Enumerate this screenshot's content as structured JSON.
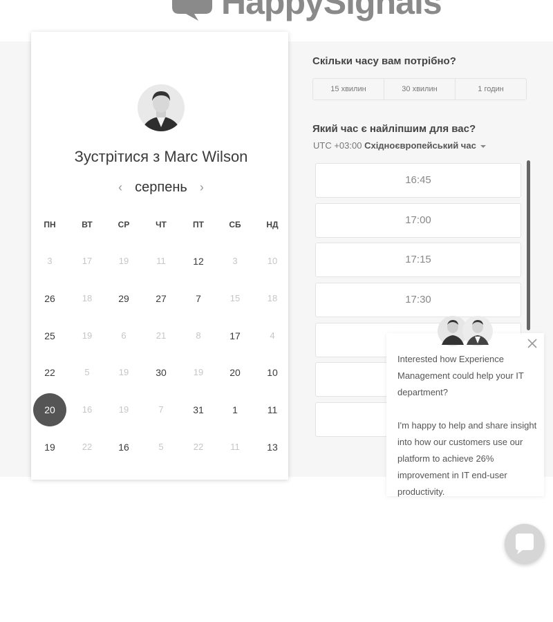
{
  "logo": {
    "text": "HappySignals"
  },
  "meeting": {
    "title": "Зустрітися з Marc Wilson",
    "month": "серпень",
    "weekdays": [
      "ПН",
      "ВТ",
      "СР",
      "ЧТ",
      "ПТ",
      "СБ",
      "НД"
    ],
    "days": [
      [
        "3",
        "17",
        "19",
        "11",
        "12",
        "3",
        "10"
      ],
      [
        "26",
        "18",
        "29",
        "27",
        "7",
        "15",
        "18"
      ],
      [
        "25",
        "19",
        "6",
        "21",
        "8",
        "17",
        "4"
      ],
      [
        "22",
        "5",
        "19",
        "30",
        "19",
        "20",
        "10"
      ],
      [
        "20",
        "16",
        "19",
        "7",
        "31",
        "1",
        "11"
      ],
      [
        "19",
        "22",
        "16",
        "5",
        "22",
        "11",
        "13"
      ]
    ],
    "available": [
      [
        false,
        false,
        false,
        false,
        true,
        false,
        false
      ],
      [
        true,
        false,
        true,
        true,
        true,
        false,
        false
      ],
      [
        true,
        false,
        false,
        false,
        false,
        true,
        false
      ],
      [
        true,
        false,
        false,
        true,
        false,
        true,
        true
      ],
      [
        true,
        false,
        false,
        false,
        true,
        true,
        true
      ],
      [
        true,
        false,
        true,
        false,
        false,
        false,
        true
      ]
    ],
    "selected_day": "20"
  },
  "duration": {
    "question": "Скільки часу вам потрібно?",
    "options": [
      "15 хвилин",
      "30 хвилин",
      "1 годин"
    ]
  },
  "time": {
    "question": "Який час є найліпшим для вас?",
    "timezone_offset": "UTC +03:00",
    "timezone_name": "Східноєвропейський час",
    "slots": [
      "16:45",
      "17:00",
      "17:15",
      "17:30",
      "",
      "",
      ""
    ]
  },
  "chat": {
    "message_1": "Interested how Experience Management could help your IT department?",
    "message_2": "I'm happy to help and share insight into how our customers use our platform to achieve 26% improvement in IT end-user productivity."
  }
}
